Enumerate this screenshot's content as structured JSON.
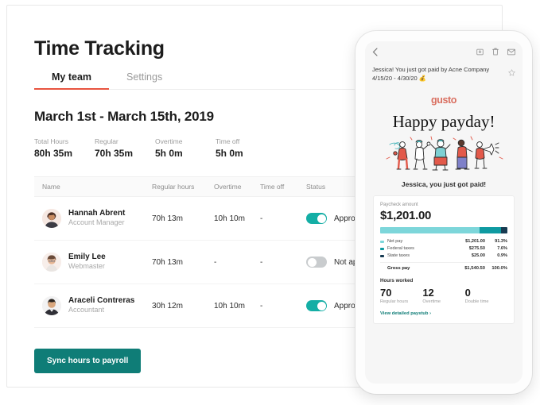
{
  "desktop": {
    "page_title": "Time Tracking",
    "tabs": [
      {
        "label": "My team",
        "active": true
      },
      {
        "label": "Settings",
        "active": false
      }
    ],
    "date_range": "March 1st - March 15th, 2019",
    "summary": [
      {
        "label": "Total Hours",
        "value": "80h 35m"
      },
      {
        "label": "Regular",
        "value": "70h 35m"
      },
      {
        "label": "Overtime",
        "value": "5h 0m"
      },
      {
        "label": "Time off",
        "value": "5h 0m"
      }
    ],
    "table": {
      "columns": [
        "Name",
        "Regular hours",
        "Overtime",
        "Time off",
        "Status"
      ],
      "rows": [
        {
          "name": "Hannah Abrent",
          "role": "Account Manager",
          "regular_hours": "70h 13m",
          "overtime": "10h 10m",
          "time_off": "-",
          "status": "Approved",
          "approved": true
        },
        {
          "name": "Emily Lee",
          "role": "Webmaster",
          "regular_hours": "70h 13m",
          "overtime": "-",
          "time_off": "-",
          "status": "Not approved",
          "approved": false
        },
        {
          "name": "Araceli Contreras",
          "role": "Accountant",
          "regular_hours": "30h 12m",
          "overtime": "10h 10m",
          "time_off": "-",
          "status": "Approved",
          "approved": true
        }
      ]
    },
    "sync_button": "Sync hours to payroll",
    "accent_color": "#e8543f",
    "teal_color": "#0f7d77"
  },
  "phone": {
    "mail_header": {
      "back_icon": "chevron-left-icon",
      "icons": [
        "archive-icon",
        "trash-icon",
        "mail-icon"
      ],
      "star_icon": "star-icon"
    },
    "subject": "Jessica! You just got paid by Acne Company 4/15/20 - 4/30/20 💰",
    "brand": "gusto",
    "headline": "Happy payday!",
    "greeting": "Jessica, you just got paid!",
    "paycheck": {
      "label": "Paycheck amount",
      "amount": "$1,201.00",
      "breakdown": [
        {
          "name": "Net pay",
          "value": "$1,201.00",
          "pct": "91.3%",
          "color": "#7dd6da",
          "width": 78
        },
        {
          "name": "Federal taxes",
          "value": "$275.50",
          "pct": "7.6%",
          "color": "#0f9aa1",
          "width": 17
        },
        {
          "name": "State taxes",
          "value": "$25.00",
          "pct": "0.9%",
          "color": "#173b52",
          "width": 5
        }
      ],
      "total": {
        "name": "Gross pay",
        "value": "$1,540.50",
        "pct": "100.0%"
      }
    },
    "hours": {
      "title": "Hours worked",
      "items": [
        {
          "num": "70",
          "label": "Regular hours"
        },
        {
          "num": "12",
          "label": "Overtime"
        },
        {
          "num": "0",
          "label": "Double time"
        }
      ]
    },
    "paystub_link": "View detailed paystub ›"
  }
}
